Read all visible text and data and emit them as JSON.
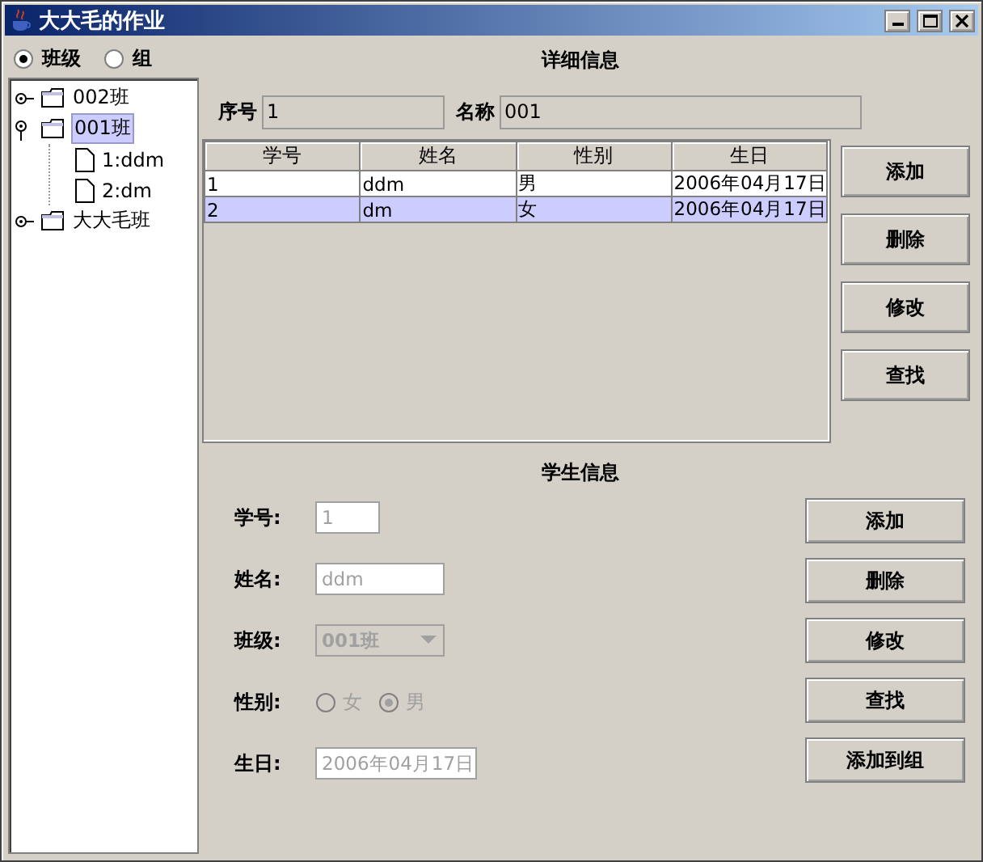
{
  "window": {
    "title": "大大毛的作业"
  },
  "mode_options": [
    {
      "label": "班级",
      "selected": true
    },
    {
      "label": "组",
      "selected": false
    }
  ],
  "tree": [
    {
      "label": "002班",
      "kind": "folder",
      "expanded": false,
      "selected": false
    },
    {
      "label": "001班",
      "kind": "folder",
      "expanded": true,
      "selected": true,
      "children": [
        {
          "label": "1:ddm",
          "kind": "leaf",
          "selected": false
        },
        {
          "label": "2:dm",
          "kind": "leaf",
          "selected": false
        }
      ]
    },
    {
      "label": "大大毛班",
      "kind": "folder",
      "expanded": false,
      "selected": false
    }
  ],
  "detail": {
    "title": "详细信息",
    "fields": [
      {
        "label": "序号",
        "value": "1"
      },
      {
        "label": "名称",
        "value": "001"
      }
    ],
    "table": {
      "columns": [
        "学号",
        "姓名",
        "性别",
        "生日"
      ],
      "rows": [
        {
          "cells": [
            "1",
            "ddm",
            "男",
            "2006年04月17日"
          ],
          "selected": false
        },
        {
          "cells": [
            "2",
            "dm",
            "女",
            "2006年04月17日"
          ],
          "selected": true
        }
      ]
    },
    "buttons": [
      "添加",
      "删除",
      "修改",
      "查找"
    ]
  },
  "student": {
    "title": "学生信息",
    "fields": [
      {
        "label": "学号:",
        "kind": "text",
        "value": "1",
        "disabled": true
      },
      {
        "label": "姓名:",
        "kind": "text",
        "value": "ddm",
        "disabled": true
      },
      {
        "label": "班级:",
        "kind": "combo",
        "value": "001班",
        "disabled": true
      },
      {
        "label": "性别:",
        "kind": "radio",
        "disabled": true,
        "options": [
          {
            "label": "女",
            "selected": false
          },
          {
            "label": "男",
            "selected": true
          }
        ]
      },
      {
        "label": "生日:",
        "kind": "text",
        "value": "2006年04月17日",
        "disabled": true
      }
    ],
    "buttons": [
      "添加",
      "删除",
      "修改",
      "查找",
      "添加到组"
    ]
  }
}
